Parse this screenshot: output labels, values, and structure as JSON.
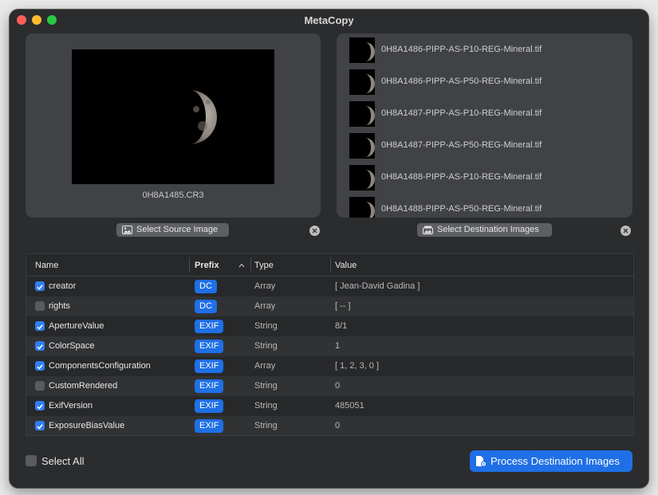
{
  "window": {
    "title": "MetaCopy"
  },
  "traffic_lights": {
    "close_color": "#ff5f57",
    "minimize_color": "#febc2e",
    "zoom_color": "#28c840"
  },
  "source": {
    "filename": "0H8A1485.CR3",
    "select_button_label": "Select Source Image",
    "image_icon": "photo-icon",
    "clear_icon": "close-circle-icon"
  },
  "destination": {
    "select_button_label": "Select Destination Images",
    "button_icon": "photo-stack-icon",
    "clear_icon": "close-circle-icon",
    "files": [
      "0H8A1486-PIPP-AS-P10-REG-Mineral.tif",
      "0H8A1486-PIPP-AS-P50-REG-Mineral.tif",
      "0H8A1487-PIPP-AS-P10-REG-Mineral.tif",
      "0H8A1487-PIPP-AS-P50-REG-Mineral.tif",
      "0H8A1488-PIPP-AS-P10-REG-Mineral.tif",
      "0H8A1488-PIPP-AS-P50-REG-Mineral.tif"
    ]
  },
  "table": {
    "headers": {
      "name": "Name",
      "prefix": "Prefix",
      "type": "Type",
      "value": "Value"
    },
    "sort_icon": "chevron-up-icon",
    "rows": [
      {
        "checked": true,
        "name": "creator",
        "prefix": "DC",
        "type": "Array",
        "value": "[ Jean-David Gadina ]"
      },
      {
        "checked": false,
        "name": "rights",
        "prefix": "DC",
        "type": "Array",
        "value": "[ -- ]"
      },
      {
        "checked": true,
        "name": "ApertureValue",
        "prefix": "EXIF",
        "type": "String",
        "value": "8/1"
      },
      {
        "checked": true,
        "name": "ColorSpace",
        "prefix": "EXIF",
        "type": "String",
        "value": "1"
      },
      {
        "checked": true,
        "name": "ComponentsConfiguration",
        "prefix": "EXIF",
        "type": "Array",
        "value": "[ 1, 2, 3, 0 ]"
      },
      {
        "checked": false,
        "name": "CustomRendered",
        "prefix": "EXIF",
        "type": "String",
        "value": "0"
      },
      {
        "checked": true,
        "name": "ExifVersion",
        "prefix": "EXIF",
        "type": "String",
        "value": "485051"
      },
      {
        "checked": true,
        "name": "ExposureBiasValue",
        "prefix": "EXIF",
        "type": "String",
        "value": "0"
      }
    ]
  },
  "footer": {
    "select_all_label": "Select All",
    "select_all_checked": false,
    "process_button_label": "Process Destination Images",
    "process_icon": "document-gear-icon"
  },
  "colors": {
    "accent": "#1f6fe6",
    "window_bg": "#2b2c2e",
    "panel_bg": "#404245"
  }
}
